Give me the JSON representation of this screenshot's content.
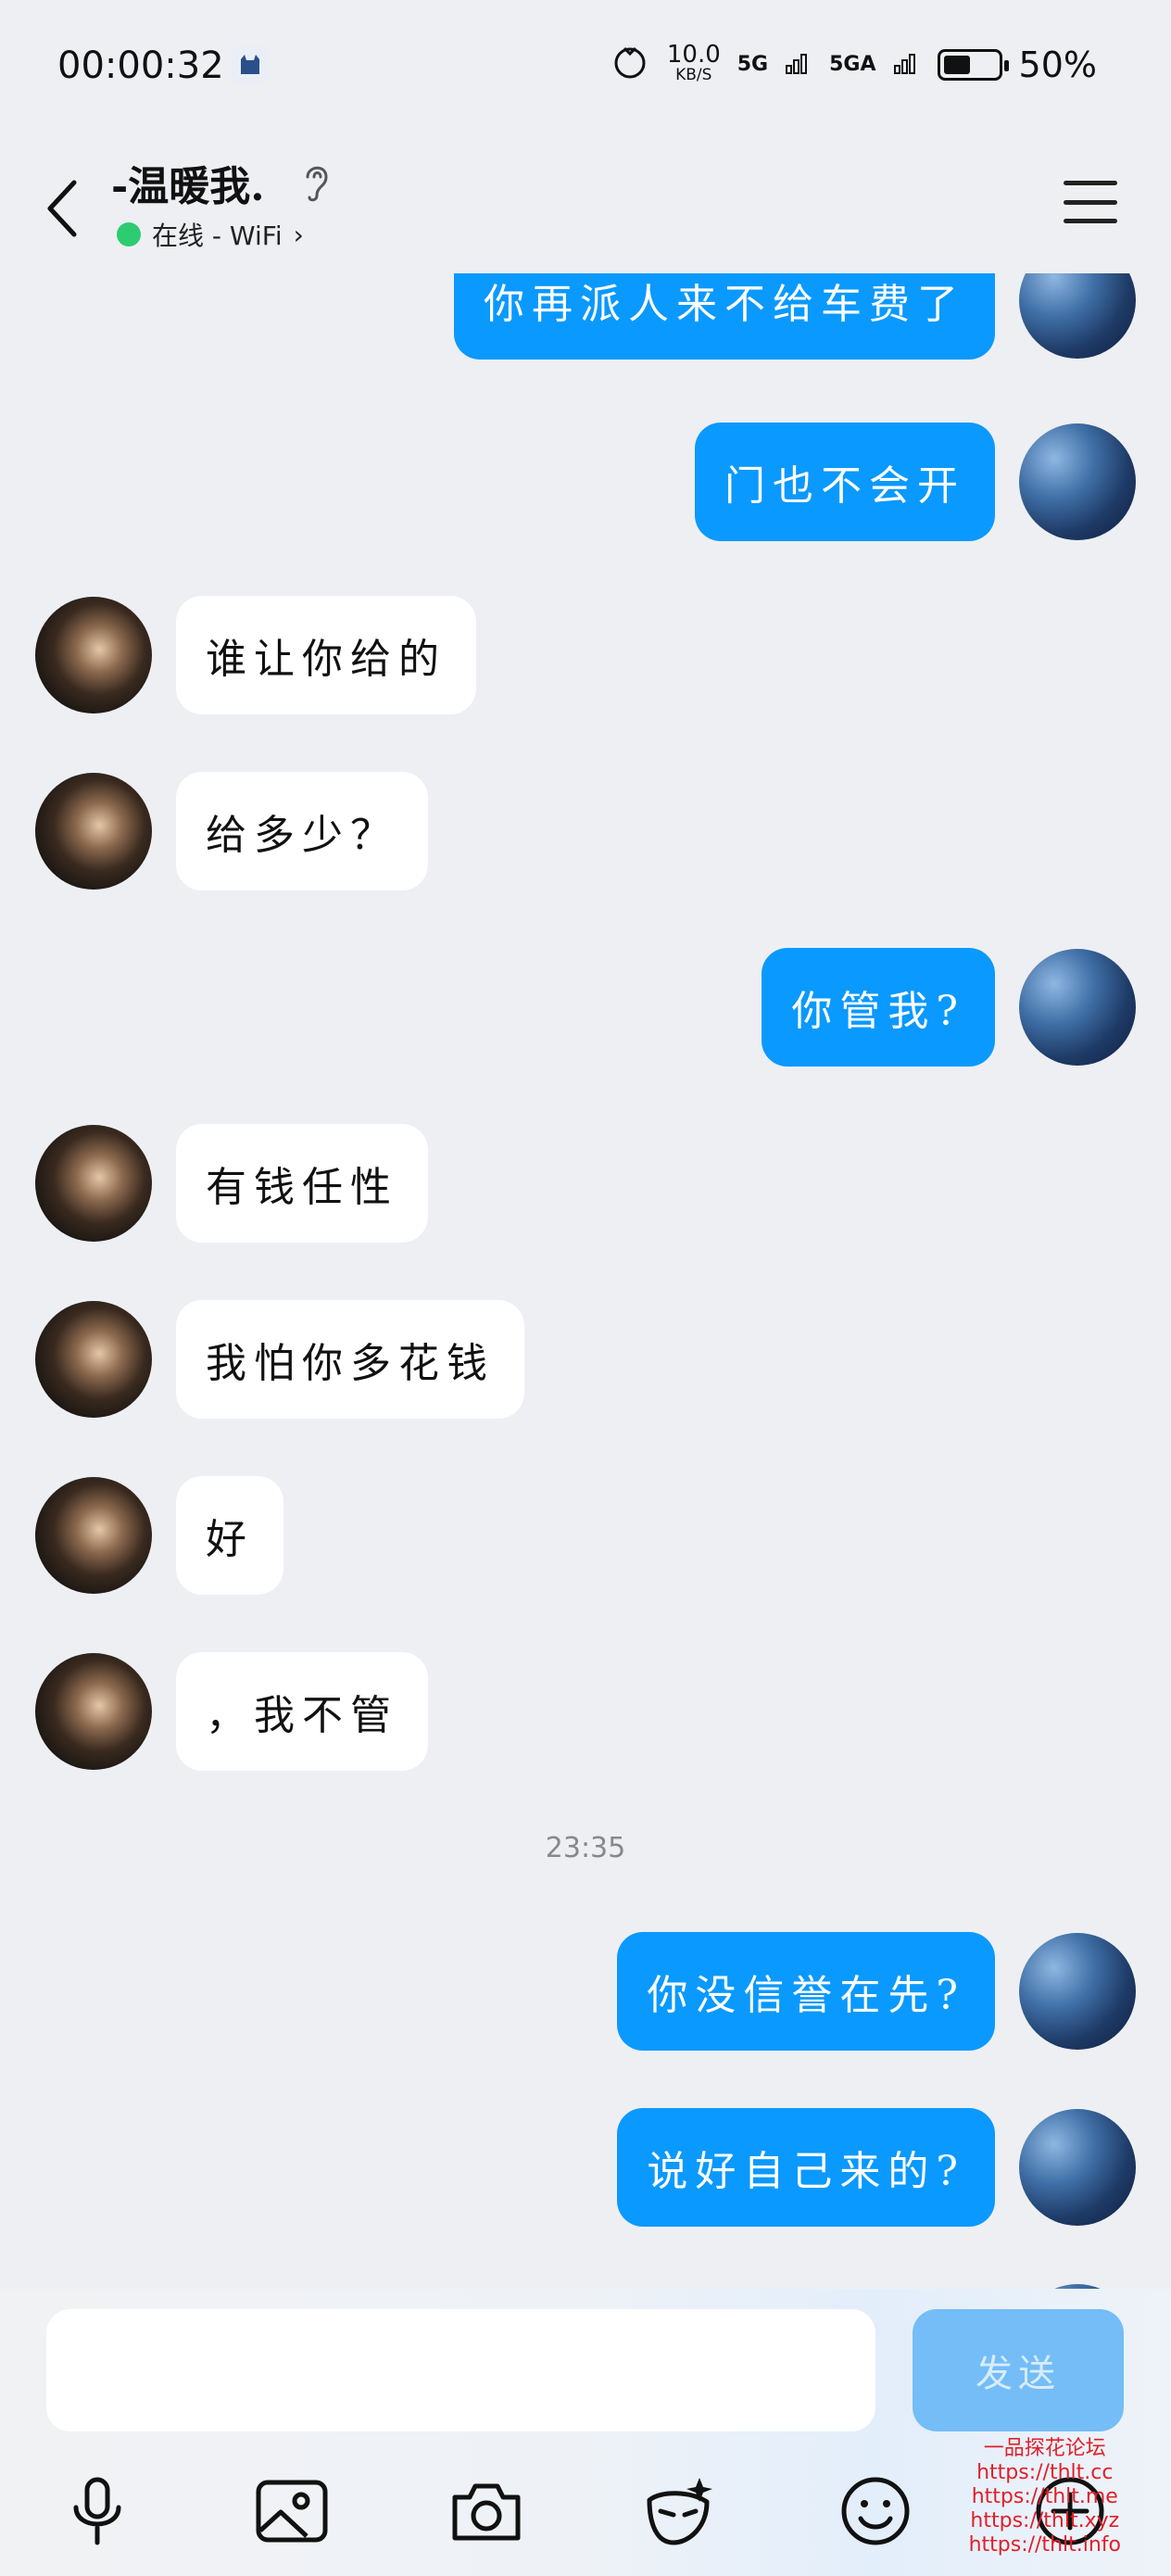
{
  "status_bar": {
    "time": "00:00:32",
    "net_speed": "10.0",
    "net_speed_unit": "KB/S",
    "signal1": "5G",
    "signal2": "5GA",
    "battery_level": 0.5,
    "battery_percent": "50%"
  },
  "header": {
    "title": "-温暖我.",
    "status": "在线 - WiFi",
    "status_chevron": "›"
  },
  "messages": [
    {
      "side": "me",
      "text": "你再派人来不给车费了"
    },
    {
      "side": "me",
      "text": "门也不会开"
    },
    {
      "side": "her",
      "text": "谁让你给的"
    },
    {
      "side": "her",
      "text": "给多少？"
    },
    {
      "side": "me",
      "text": "你管我?"
    },
    {
      "side": "her",
      "text": "有钱任性"
    },
    {
      "side": "her",
      "text": "我怕你多花钱"
    },
    {
      "side": "her",
      "text": "好"
    },
    {
      "side": "her",
      "text": "，我不管"
    },
    {
      "side": "me",
      "text": "你没信誉在先?"
    },
    {
      "side": "me",
      "text": "说好自己来的?"
    }
  ],
  "timestamp": "23:35",
  "input": {
    "send_label": "发送"
  },
  "toolbar_icons": [
    "microphone-icon",
    "image-icon",
    "camera-icon",
    "mask-emoji-icon",
    "smiley-icon",
    "plus-icon"
  ],
  "watermark": {
    "line1": "一品探花论坛",
    "line2": "https://thlt.cc",
    "line3": "https://thlt.me",
    "line4": "https://thlt.xyz",
    "line5": "https://thlt.info"
  }
}
